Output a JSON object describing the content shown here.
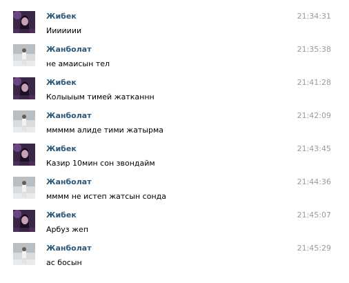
{
  "messages": [
    {
      "author": "Жибек",
      "text": "Иииииии",
      "time": "21:34:31",
      "avatar": "zhibek"
    },
    {
      "author": "Жанболат",
      "text": "не амаисын тел",
      "time": "21:35:38",
      "avatar": "zhanbolat"
    },
    {
      "author": "Жибек",
      "text": "Колыыым тимей жатканнн",
      "time": "21:41:28",
      "avatar": "zhibek"
    },
    {
      "author": "Жанболат",
      "text": "ммммм алиде тими жатырма",
      "time": "21:42:09",
      "avatar": "zhanbolat"
    },
    {
      "author": "Жибек",
      "text": "Казир 10мин сон звондайм",
      "time": "21:43:45",
      "avatar": "zhibek"
    },
    {
      "author": "Жанболат",
      "text": "мммм не истеп жатсын сонда",
      "time": "21:44:36",
      "avatar": "zhanbolat"
    },
    {
      "author": "Жибек",
      "text": "Арбуз жеп",
      "time": "21:45:07",
      "avatar": "zhibek"
    },
    {
      "author": "Жанболат",
      "text": "ас босын",
      "time": "21:45:29",
      "avatar": "zhanbolat"
    }
  ],
  "colors": {
    "author_link": "#2b587a",
    "time": "#999999",
    "text": "#000000"
  }
}
